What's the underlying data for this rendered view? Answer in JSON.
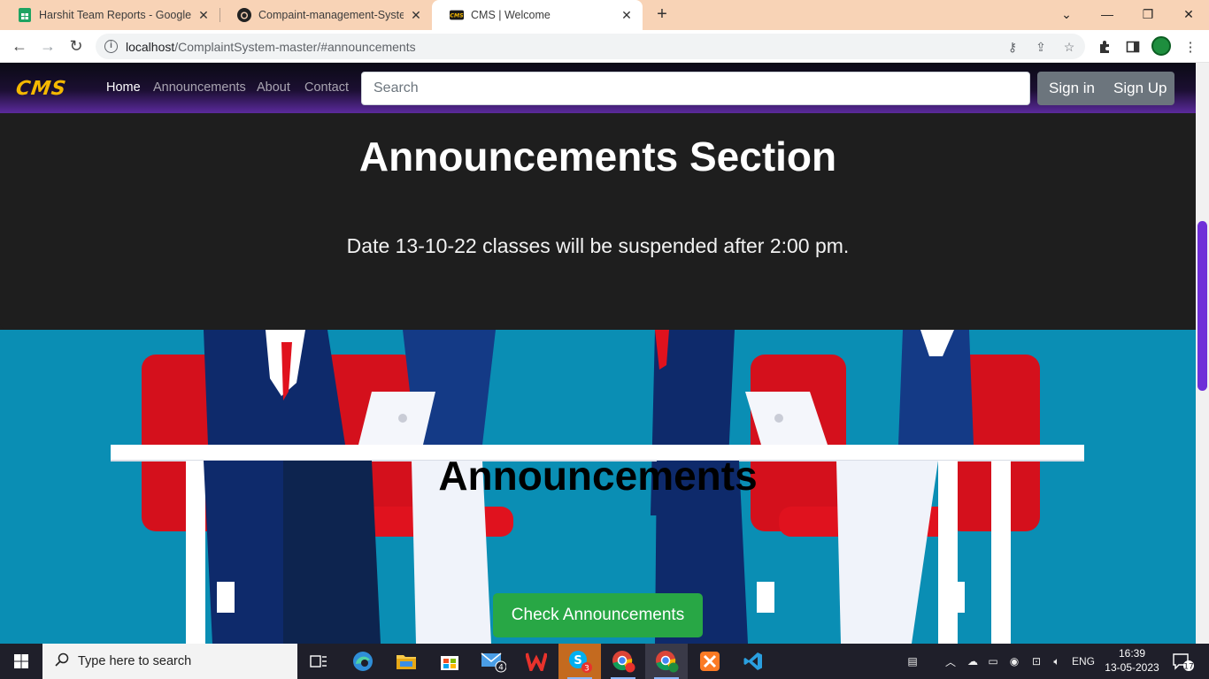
{
  "browser": {
    "tabs": [
      {
        "label": "Harshit Team Reports - Google Sheets",
        "icon": "google-sheets-icon"
      },
      {
        "label": "Compaint-management-System-",
        "icon": "github-icon"
      },
      {
        "label": "CMS | Welcome",
        "icon": "cms-favicon",
        "active": true
      }
    ],
    "url_host": "localhost",
    "url_path": "/ComplaintSystem-master/#announcements"
  },
  "navbar": {
    "brand": "CMS",
    "links": [
      "Home",
      "Announcements",
      "About",
      "Contact"
    ],
    "active_link": "Home",
    "search_placeholder": "Search",
    "signin_label": "Sign in",
    "signup_label": "Sign Up"
  },
  "announcements": {
    "title": "Announcements Section",
    "text": "Date 13-10-22 classes will be suspended after 2:00 pm."
  },
  "hero": {
    "title": "Announcements",
    "button_label": "Check Announcements"
  },
  "taskbar": {
    "search_placeholder": "Type here to search",
    "language": "ENG",
    "time": "16:39",
    "date": "13-05-2023",
    "notification_count": "17",
    "mail_badge": "4",
    "skype_badge": "3"
  },
  "colors": {
    "tabstrip": "#f8d3b6",
    "brand": "#f5b800",
    "nav_gradient_end": "#5b2a9c",
    "hero_bg": "#0a8eb4",
    "button_green": "#28a745",
    "section_bg": "#1e1e1e"
  }
}
